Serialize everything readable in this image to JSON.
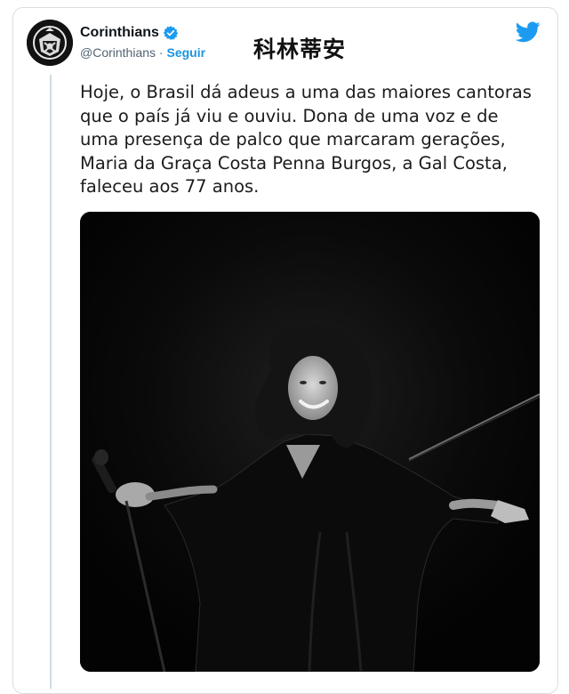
{
  "account": {
    "name": "Corinthians",
    "handle": "@Corinthians",
    "separator": " · ",
    "follow_label": "Seguir"
  },
  "overlay": {
    "watermark_text": "科林蒂安"
  },
  "tweet": {
    "lines": [
      "Hoje, o Brasil dá adeus a uma das maiores cantoras",
      "que o país já viu e ouviu. Dona de uma voz e de",
      "uma presença de palco que marcaram gerações,",
      "Maria da Graça Costa Penna Burgos, a Gal Costa,",
      "faleceu aos 77 anos."
    ]
  },
  "colors": {
    "twitter_blue": "#1d9bf0",
    "follow_blue": "#1b95e0",
    "handle_gray": "#536471"
  },
  "icons": {
    "verified": "verified-badge-icon",
    "bird": "twitter-bird-icon",
    "avatar": "corinthians-crest-icon"
  }
}
